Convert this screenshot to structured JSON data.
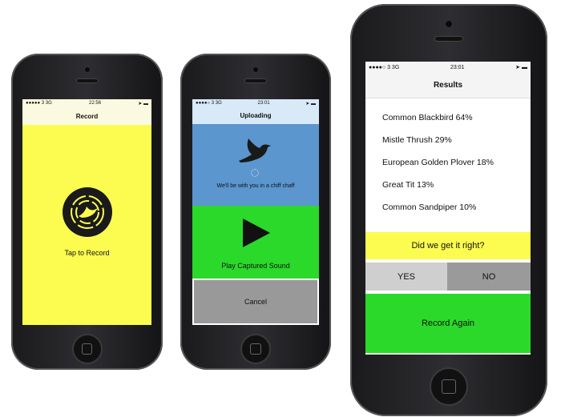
{
  "phone1": {
    "status": {
      "carrier": "●●●●● 3  3G",
      "time": "22:56"
    },
    "nav_title": "Record",
    "record_label": "Tap to Record",
    "bg": "#fcfc50"
  },
  "phone2": {
    "status": {
      "carrier": "●●●●○ 3  3G",
      "time": "23:01"
    },
    "nav_title": "Uploading",
    "wait_text": "We'll be with you in a chiff chaff",
    "play_label": "Play Captured Sound",
    "cancel_label": "Cancel"
  },
  "phone3": {
    "status": {
      "carrier": "●●●●○ 3  3G",
      "time": "23:01"
    },
    "nav_title": "Results",
    "results": [
      "Common Blackbird 64%",
      "Mistle Thrush 29%",
      "European Golden Plover 18%",
      "Great Tit 13%",
      "Common Sandpiper 10%"
    ],
    "question": "Did we get it right?",
    "yes_label": "YES",
    "no_label": "NO",
    "record_again_label": "Record Again"
  }
}
